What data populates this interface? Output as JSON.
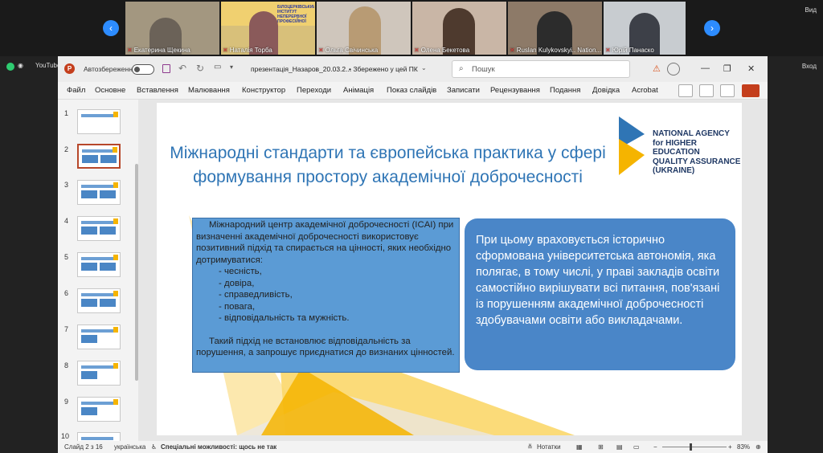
{
  "video": {
    "participants": [
      {
        "name": "Екатерина Щекина",
        "muted": true
      },
      {
        "name": "Наталія Торба",
        "muted": true
      },
      {
        "name": "Ольга Свічинська",
        "muted": true
      },
      {
        "name": "Олена Бекетова",
        "muted": true
      },
      {
        "name": "Ruslan Kulykovskyi.. Nation...",
        "muted": true
      },
      {
        "name": "Юрій Панаско",
        "muted": true
      }
    ],
    "banner_text": "БІЛОЦЕРКІВСЬКИЙ ІНСТИТУТ НЕПЕРЕРВНОЇ ПРОФЕСІЙНОЇ ОСВІТИ",
    "view_label": "Вид",
    "login_label": "Вход",
    "youtube_label": "YouTube"
  },
  "titlebar": {
    "autosave_label": "Автозбереження",
    "filename": "презентація_Назаров_20.03.2...",
    "saved_status": "• Збережено у цей ПК",
    "search_placeholder": "Пошук"
  },
  "ribbon": {
    "tabs": [
      "Файл",
      "Основне",
      "Вставлення",
      "Малювання",
      "Конструктор",
      "Переходи",
      "Анімація",
      "Показ слайдів",
      "Записати",
      "Рецензування",
      "Подання",
      "Довідка",
      "Acrobat"
    ]
  },
  "thumbnails": {
    "numbers": [
      "1",
      "2",
      "3",
      "4",
      "5",
      "6",
      "7",
      "8",
      "9",
      "10"
    ],
    "active_index": 2
  },
  "slide": {
    "title": "Міжнародні стандарти та європейська практика у сфері формування простору академічної доброчесності",
    "logo_lines": [
      "NATIONAL AGENCY",
      "for HIGHER EDUCATION",
      "QUALITY ASSURANCE",
      "(UKRAINE)"
    ],
    "left_intro": "Міжнародний центр академічної доброчесності (ICAI) при визначенні академічної доброчесності використовує позитивний підхід та спирається на цінності, яких необхідно дотримуватися:",
    "values_list": [
      "- чесність,",
      "- довіра,",
      "- справедливість,",
      "- повага,",
      "- відповідальність та мужність."
    ],
    "left_outro": "Такий підхід не встановлює відповідальність за порушення, а запрошує приєднатися до визнаних цінностей.",
    "right_text": "При цьому враховується історично сформована університетська автономія, яка полягає, в тому числі, у праві закладів освіти самостійно вирішувати всі питання, пов'язані із порушенням академічної доброчесності здобувачами освіти або викладачами."
  },
  "statusbar": {
    "slide_counter": "Слайд 2 з 16",
    "language": "українська",
    "accessibility": "Спеціальні можливості: щось не так",
    "notes_label": "Нотатки",
    "zoom": "83%"
  },
  "colors": {
    "title_blue": "#2f75b5",
    "box_blue": "#5b9bd5",
    "round_box_blue": "#4a86c8",
    "logo_yellow": "#f5b400",
    "logo_blue": "#2f75b5",
    "powerpoint_accent": "#b7472a"
  }
}
